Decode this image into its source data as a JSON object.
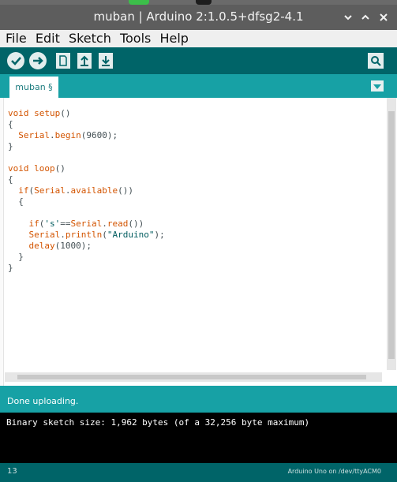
{
  "window": {
    "title": "muban | Arduino 2:1.0.5+dfsg2-4.1",
    "controls": [
      "minimize-icon",
      "maximize-icon",
      "close-icon"
    ]
  },
  "menu": [
    "File",
    "Edit",
    "Sketch",
    "Tools",
    "Help"
  ],
  "toolbar": {
    "buttons": [
      "verify-icon",
      "upload-icon",
      "new-icon",
      "open-icon",
      "save-icon"
    ],
    "right_button": "serial-monitor-icon"
  },
  "tabs": [
    {
      "label": "muban §"
    }
  ],
  "editor": {
    "lines": [
      "void setup()",
      "{",
      "  Serial.begin(9600);",
      "}",
      "",
      "void loop()",
      "{",
      "  if(Serial.available())",
      "  {",
      "",
      "    if('s'==Serial.read())",
      "    Serial.println(\"Arduino\");",
      "    delay(1000);",
      "  }",
      "}"
    ]
  },
  "status": {
    "message": "Done uploading."
  },
  "console": {
    "text": "Binary sketch size: 1,962 bytes (of a 32,256 byte maximum)"
  },
  "footer": {
    "line": "13",
    "board": "Arduino Uno on /dev/ttyACM0"
  },
  "colors": {
    "toolbar": "#006468",
    "tabbar": "#17a1a5",
    "keyword": "#d35400",
    "string": "#005c5f"
  }
}
